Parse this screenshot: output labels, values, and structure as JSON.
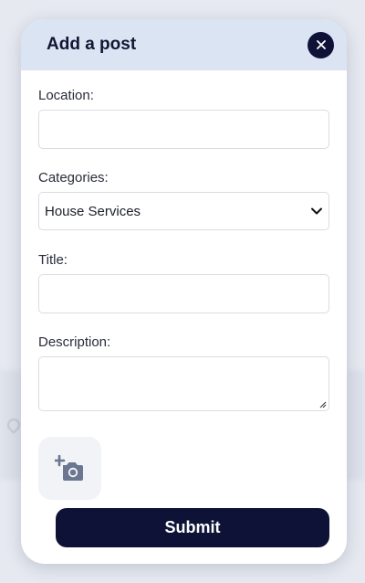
{
  "modal": {
    "title": "Add a post",
    "close_icon": "close-icon"
  },
  "form": {
    "location": {
      "label": "Location:",
      "value": "",
      "placeholder": ""
    },
    "categories": {
      "label": "Categories:",
      "selected": "House Services",
      "icon": "chevron-down-icon"
    },
    "title": {
      "label": "Title:",
      "value": "",
      "placeholder": ""
    },
    "description": {
      "label": "Description:",
      "value": ""
    },
    "photo": {
      "icon": "add-photo-icon"
    },
    "submit_label": "Submit"
  },
  "colors": {
    "accent": "#0e1236",
    "header_bg": "#dbe4f2",
    "photo_icon": "#6b7691"
  }
}
